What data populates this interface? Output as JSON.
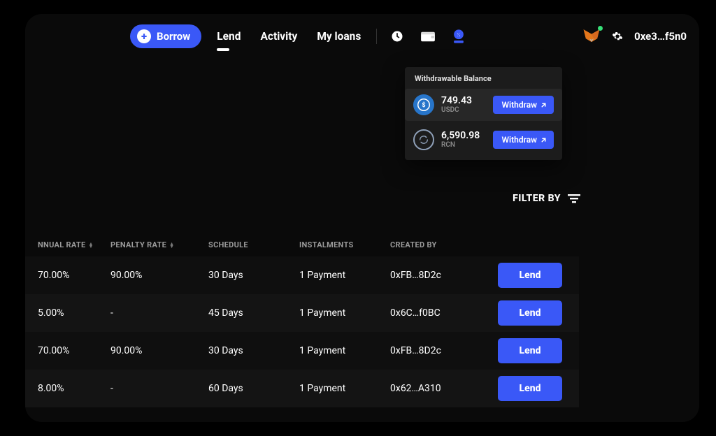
{
  "nav": {
    "borrow_label": "Borrow",
    "links": [
      "Lend",
      "Activity",
      "My loans"
    ],
    "active_index": 0,
    "address": "0xe3…f5n0"
  },
  "dropdown": {
    "title": "Withdrawable Balance",
    "balances": [
      {
        "amount": "749.43",
        "symbol": "USDC",
        "icon": "usdc",
        "action": "Withdraw"
      },
      {
        "amount": "6,590.98",
        "symbol": "RCN",
        "icon": "rcn",
        "action": "Withdraw"
      }
    ]
  },
  "filter": {
    "label": "FILTER BY"
  },
  "table": {
    "headers": {
      "annual_rate": "NNUAL RATE",
      "penalty_rate": "PENALTY RATE",
      "schedule": "SCHEDULE",
      "instalments": "INSTALMENTS",
      "created_by": "CREATED BY"
    },
    "rows": [
      {
        "annual": "70.00%",
        "penalty": "90.00%",
        "schedule": "30 Days",
        "instalments": "1 Payment",
        "created_by": "0xFB…8D2c",
        "action": "Lend"
      },
      {
        "annual": "5.00%",
        "penalty": "-",
        "schedule": "45 Days",
        "instalments": "1 Payment",
        "created_by": "0x6C…f0BC",
        "action": "Lend"
      },
      {
        "annual": "70.00%",
        "penalty": "90.00%",
        "schedule": "30 Days",
        "instalments": "1 Payment",
        "created_by": "0xFB…8D2c",
        "action": "Lend"
      },
      {
        "annual": "8.00%",
        "penalty": "-",
        "schedule": "60 Days",
        "instalments": "1 Payment",
        "created_by": "0x62…A310",
        "action": "Lend"
      }
    ]
  }
}
